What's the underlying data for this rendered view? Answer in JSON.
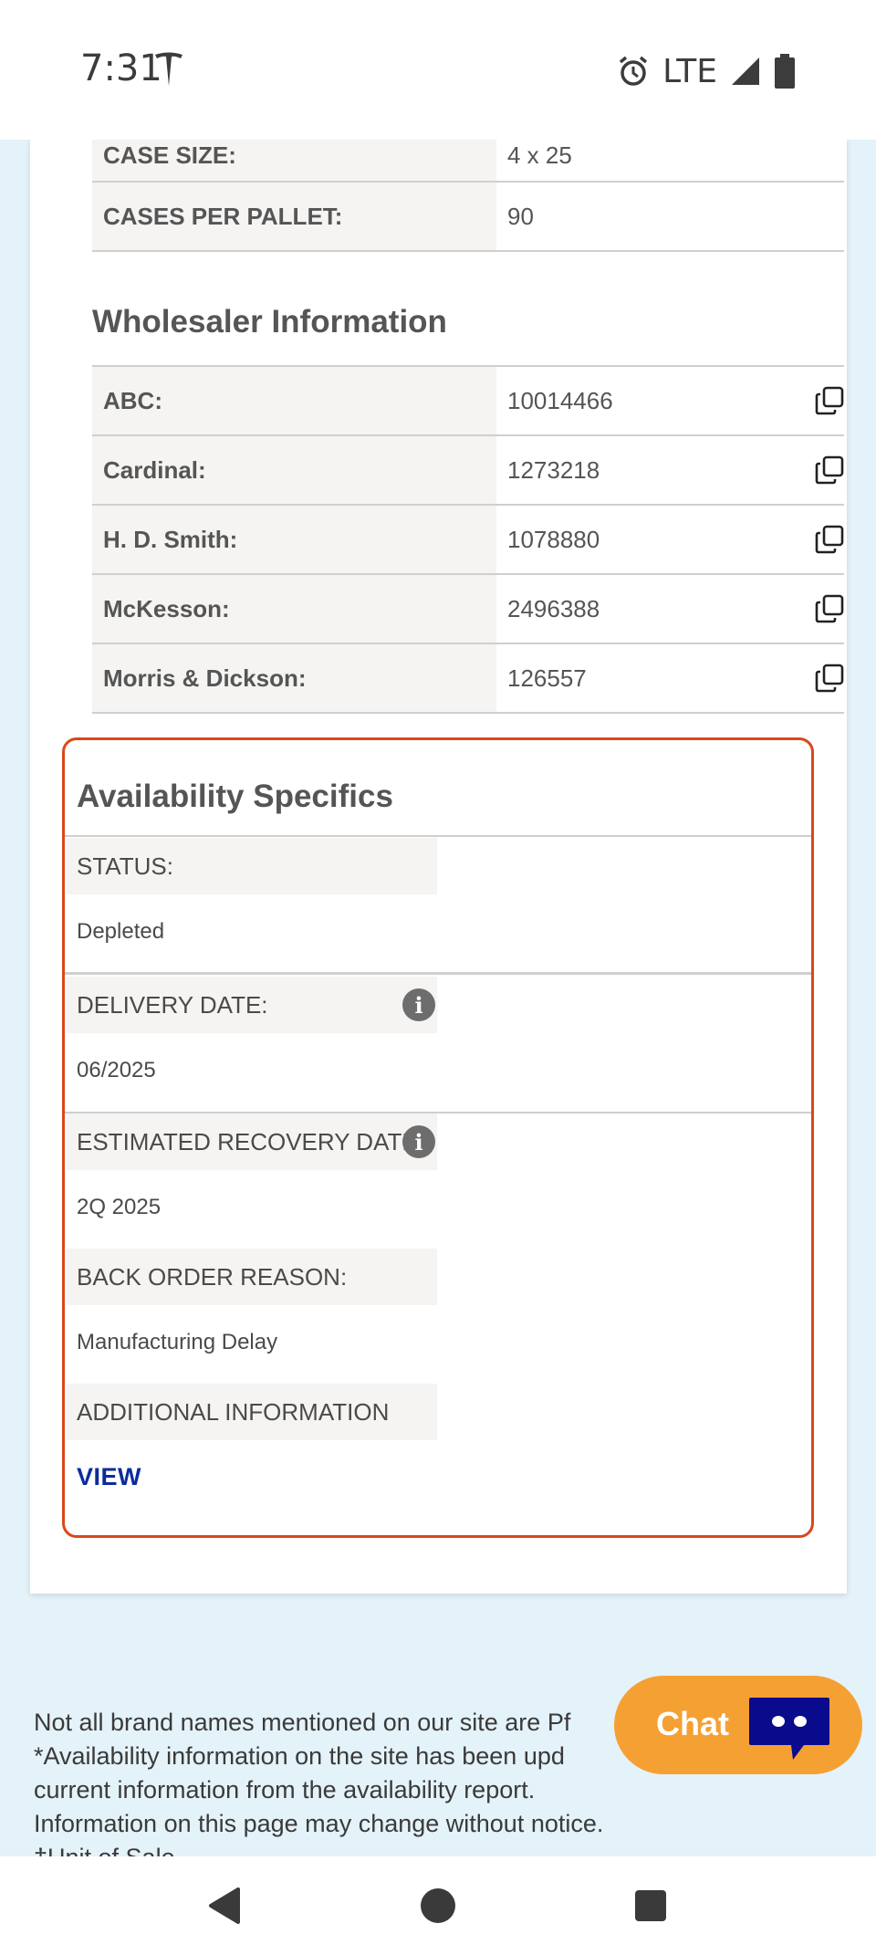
{
  "status_bar": {
    "time": "7:31",
    "network": "LTE",
    "icons": [
      "tesla-icon",
      "alarm-icon",
      "signal-icon",
      "battery-icon"
    ]
  },
  "product_specs": [
    {
      "label": "CASE SIZE:",
      "value": "4 x 25"
    },
    {
      "label": "CASES PER PALLET:",
      "value": "90"
    }
  ],
  "wholesaler": {
    "heading": "Wholesaler Information",
    "rows": [
      {
        "label": "ABC:",
        "value": "10014466"
      },
      {
        "label": "Cardinal:",
        "value": "1273218"
      },
      {
        "label": "H. D. Smith:",
        "value": "1078880"
      },
      {
        "label": "McKesson:",
        "value": "2496388"
      },
      {
        "label": "Morris & Dickson:",
        "value": "126557"
      }
    ]
  },
  "availability": {
    "heading": "Availability Specifics",
    "status_label": "STATUS:",
    "status_value": "Depleted",
    "delivery_label": "DELIVERY DATE:",
    "delivery_value": "06/2025",
    "recovery_label": "ESTIMATED RECOVERY DATE:",
    "recovery_value": "2Q 2025",
    "backorder_label": "BACK ORDER REASON:",
    "backorder_value": "Manufacturing Delay",
    "additional_label": "ADDITIONAL INFORMATION",
    "view_link": "VIEW",
    "border_color": "#d9481b"
  },
  "footer": {
    "lines": [
      "Not all brand names mentioned on our site are Pf",
      "*Availability information on the site has been upd",
      "current information from the availability report.",
      "Information on this page may change without notice.",
      "†Unit of Sale"
    ]
  },
  "chat": {
    "label": "Chat",
    "color": "#f5a033"
  },
  "colors": {
    "page_bg": "#e4f2f9",
    "link": "#0b2c9e",
    "label_bg": "#f5f4f2"
  }
}
